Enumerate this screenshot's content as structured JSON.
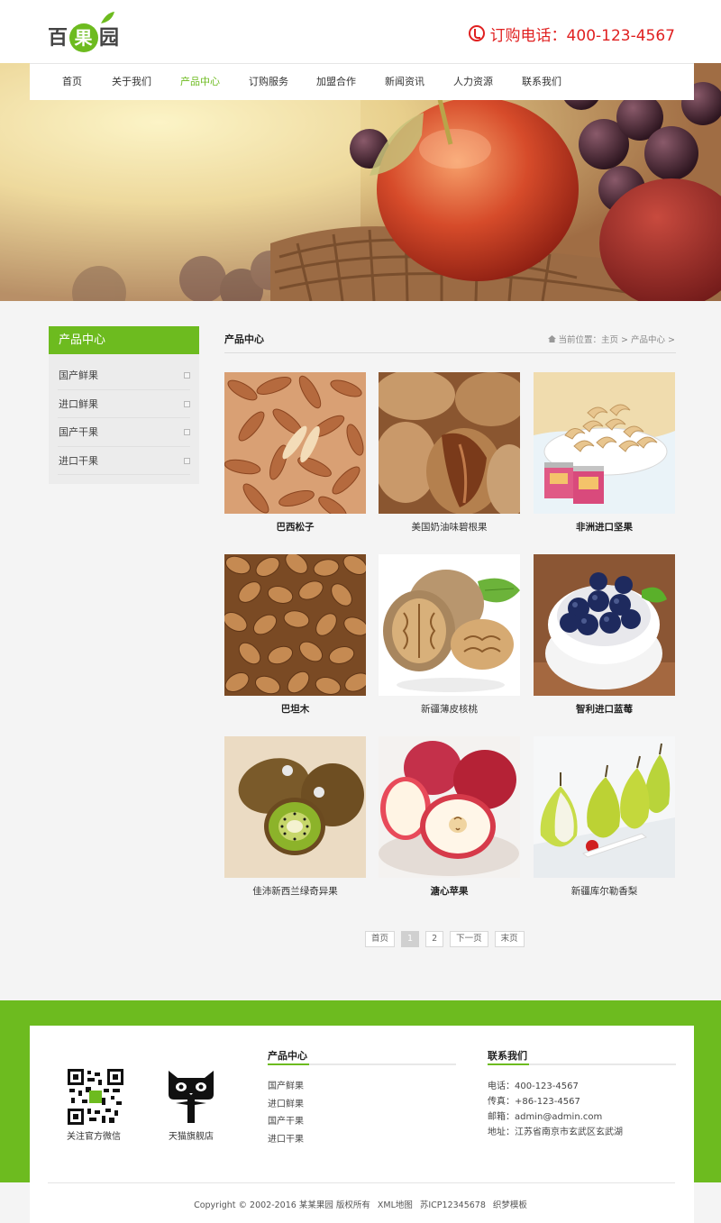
{
  "site": {
    "logo_chars": [
      "百",
      "果",
      "园"
    ],
    "hotline": "订购电话：400-123-4567",
    "brand_green": "#6dbb1f",
    "hotline_red": "#e02020"
  },
  "nav": [
    {
      "label": "首页",
      "active": false
    },
    {
      "label": "关于我们",
      "active": false
    },
    {
      "label": "产品中心",
      "active": true
    },
    {
      "label": "订购服务",
      "active": false
    },
    {
      "label": "加盟合作",
      "active": false
    },
    {
      "label": "新闻资讯",
      "active": false
    },
    {
      "label": "人力资源",
      "active": false
    },
    {
      "label": "联系我们",
      "active": false
    }
  ],
  "sidebar": {
    "title": "产品中心",
    "items": [
      "国产鲜果",
      "进口鲜果",
      "国产干果",
      "进口干果"
    ]
  },
  "main": {
    "title": "产品中心",
    "breadcrumb": "当前位置：主页 > 产品中心 >"
  },
  "products": [
    {
      "name": "巴西松子",
      "bold": true,
      "image": "pine-nuts"
    },
    {
      "name": "美国奶油味碧根果",
      "bold": false,
      "image": "pecans"
    },
    {
      "name": "非洲进口坚果",
      "bold": true,
      "image": "cashews"
    },
    {
      "name": "巴坦木",
      "bold": true,
      "image": "almonds"
    },
    {
      "name": "新疆薄皮核桃",
      "bold": false,
      "image": "walnuts"
    },
    {
      "name": "智利进口蓝莓",
      "bold": true,
      "image": "blueberries"
    },
    {
      "name": "佳沛新西兰绿奇异果",
      "bold": false,
      "image": "kiwi"
    },
    {
      "name": "溏心苹果",
      "bold": true,
      "image": "apples"
    },
    {
      "name": "新疆库尔勒香梨",
      "bold": false,
      "image": "pears"
    }
  ],
  "pager": [
    "首页",
    "1",
    "2",
    "下一页",
    "末页"
  ],
  "pager_current": "1",
  "footer": {
    "wechat_caption": "关注官方微信",
    "tmall_caption": "天猫旗舰店",
    "products_title": "产品中心",
    "product_links": [
      "国产鲜果",
      "进口鲜果",
      "国产干果",
      "进口干果"
    ],
    "contact_title": "联系我们",
    "contact_lines": [
      "电话：400-123-4567",
      "传真：+86-123-4567",
      "邮箱：admin@admin.com",
      "地址：江苏省南京市玄武区玄武湖"
    ],
    "copyright": [
      "Copyright © 2002-2016 某某果园 版权所有",
      "XML地图",
      "苏ICP12345678",
      "织梦模板"
    ]
  }
}
